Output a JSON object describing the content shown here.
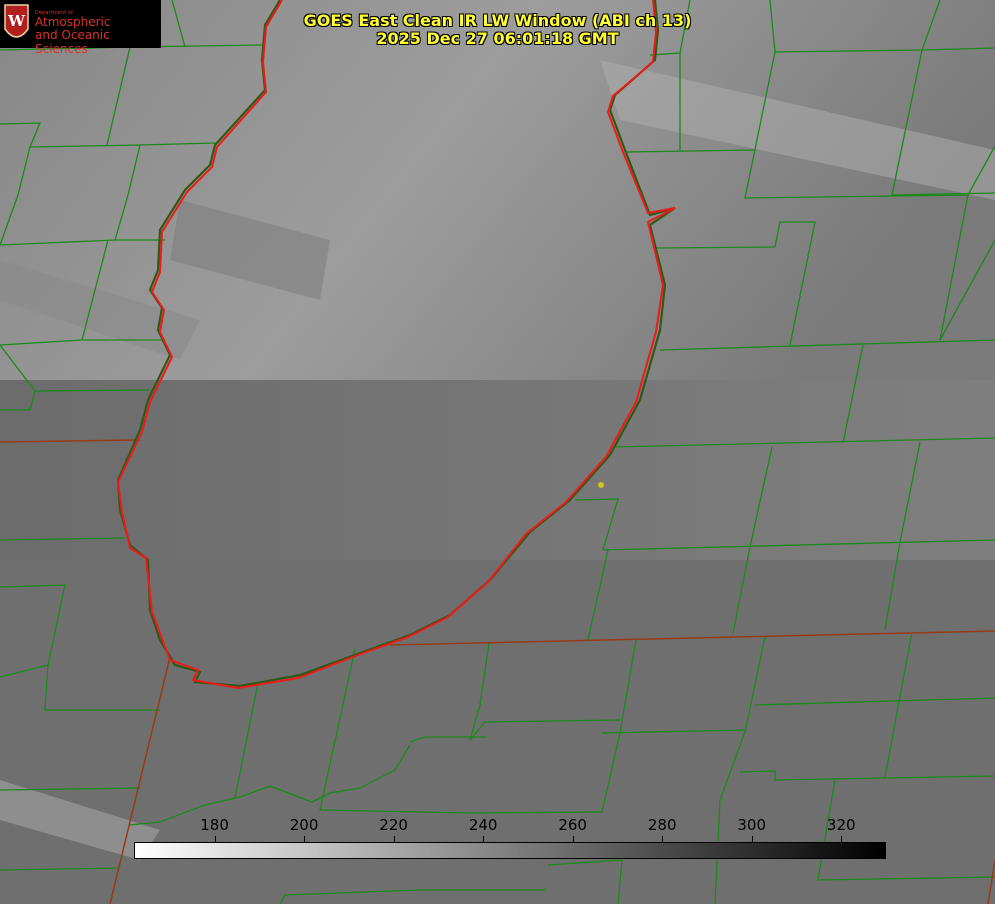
{
  "title_line1": "GOES East Clean IR LW Window (ABI ch 13)",
  "title_line2": "2025 Dec 27 06:01:18 GMT",
  "logo": {
    "department": "Department of",
    "line1": "Atmospheric",
    "line2": "and Oceanic Sciences",
    "color": "#d9322f"
  },
  "colorbar": {
    "min": 162,
    "max": 330,
    "ticks": [
      "180",
      "200",
      "220",
      "240",
      "260",
      "280",
      "300",
      "320"
    ],
    "from_color": "#ffffff",
    "to_color": "#000000"
  },
  "colors": {
    "background": "#6e6e6e",
    "county_lines": "#1a8a1a",
    "state_lines": "#9a3a14",
    "lake_outline": "#ee1a1a",
    "station_marker": "#d4c21e",
    "title": "#ffff33"
  }
}
